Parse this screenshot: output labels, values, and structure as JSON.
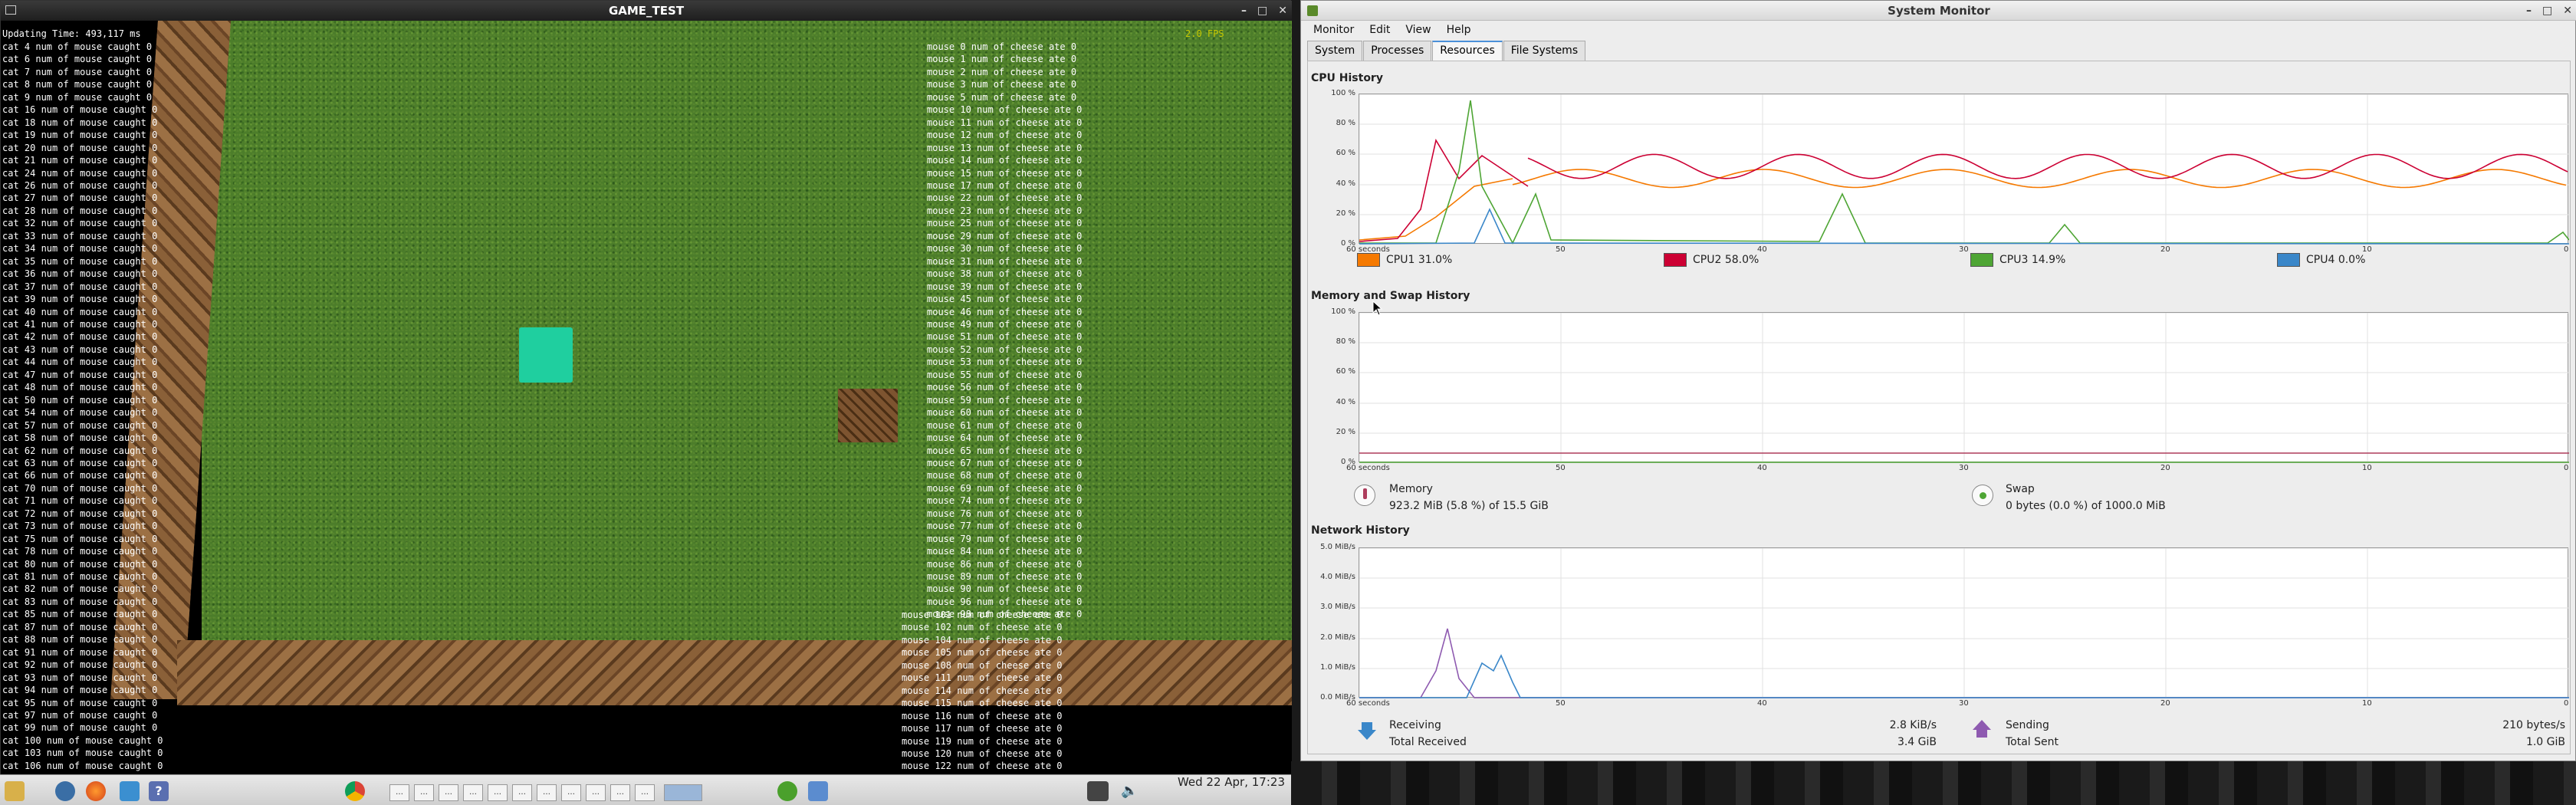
{
  "game": {
    "title": "GAME_TEST",
    "updating": "Updating Time: 493,117 ms",
    "fps": "2.0 FPS",
    "cat_lines": [
      "cat 4 num of mouse caught 0",
      "cat 6 num of mouse caught 0",
      "cat 7 num of mouse caught 0",
      "cat 8 num of mouse caught 0",
      "cat 9 num of mouse caught 0",
      "cat 16 num of mouse caught 0",
      "cat 18 num of mouse caught 0",
      "cat 19 num of mouse caught 0",
      "cat 20 num of mouse caught 0",
      "cat 21 num of mouse caught 0",
      "cat 24 num of mouse caught 0",
      "cat 26 num of mouse caught 0",
      "cat 27 num of mouse caught 0",
      "cat 28 num of mouse caught 0",
      "cat 32 num of mouse caught 0",
      "cat 33 num of mouse caught 0",
      "cat 34 num of mouse caught 0",
      "cat 35 num of mouse caught 0",
      "cat 36 num of mouse caught 0",
      "cat 37 num of mouse caught 0",
      "cat 39 num of mouse caught 0",
      "cat 40 num of mouse caught 0",
      "cat 41 num of mouse caught 0",
      "cat 42 num of mouse caught 0",
      "cat 43 num of mouse caught 0",
      "cat 44 num of mouse caught 0",
      "cat 47 num of mouse caught 0",
      "cat 48 num of mouse caught 0",
      "cat 50 num of mouse caught 0",
      "cat 54 num of mouse caught 0",
      "cat 57 num of mouse caught 0",
      "cat 58 num of mouse caught 0",
      "cat 62 num of mouse caught 0",
      "cat 63 num of mouse caught 0",
      "cat 66 num of mouse caught 0",
      "cat 70 num of mouse caught 0",
      "cat 71 num of mouse caught 0",
      "cat 72 num of mouse caught 0",
      "cat 73 num of mouse caught 0",
      "cat 75 num of mouse caught 0",
      "cat 78 num of mouse caught 0",
      "cat 80 num of mouse caught 0",
      "cat 81 num of mouse caught 0",
      "cat 82 num of mouse caught 0",
      "cat 83 num of mouse caught 0",
      "cat 85 num of mouse caught 0",
      "cat 87 num of mouse caught 0",
      "cat 88 num of mouse caught 0",
      "cat 91 num of mouse caught 0",
      "cat 92 num of mouse caught 0",
      "cat 93 num of mouse caught 0",
      "cat 94 num of mouse caught 0",
      "cat 95 num of mouse caught 0",
      "cat 97 num of mouse caught 0",
      "cat 99 num of mouse caught 0",
      "cat 100 num of mouse caught 0",
      "cat 103 num of mouse caught 0",
      "cat 106 num of mouse caught 0"
    ],
    "mouse_top": [
      "mouse 0 num of cheese ate 0",
      "mouse 1 num of cheese ate 0",
      "mouse 2 num of cheese ate 0",
      "mouse 3 num of cheese ate 0",
      "mouse 5 num of cheese ate 0",
      "mouse 10 num of cheese ate 0",
      "mouse 11 num of cheese ate 0",
      "mouse 12 num of cheese ate 0",
      "mouse 13 num of cheese ate 0",
      "mouse 14 num of cheese ate 0",
      "mouse 15 num of cheese ate 0",
      "mouse 17 num of cheese ate 0",
      "mouse 22 num of cheese ate 0",
      "mouse 23 num of cheese ate 0",
      "mouse 25 num of cheese ate 0",
      "mouse 29 num of cheese ate 0",
      "mouse 30 num of cheese ate 0",
      "mouse 31 num of cheese ate 0",
      "mouse 38 num of cheese ate 0",
      "mouse 39 num of cheese ate 0",
      "mouse 45 num of cheese ate 0",
      "mouse 46 num of cheese ate 0",
      "mouse 49 num of cheese ate 0",
      "mouse 51 num of cheese ate 0",
      "mouse 52 num of cheese ate 0",
      "mouse 53 num of cheese ate 0",
      "mouse 55 num of cheese ate 0",
      "mouse 56 num of cheese ate 0",
      "mouse 59 num of cheese ate 0",
      "mouse 60 num of cheese ate 0",
      "mouse 61 num of cheese ate 0",
      "mouse 64 num of cheese ate 0",
      "mouse 65 num of cheese ate 0",
      "mouse 67 num of cheese ate 0",
      "mouse 68 num of cheese ate 0",
      "mouse 69 num of cheese ate 0",
      "mouse 74 num of cheese ate 0",
      "mouse 76 num of cheese ate 0",
      "mouse 77 num of cheese ate 0",
      "mouse 79 num of cheese ate 0",
      "mouse 84 num of cheese ate 0",
      "mouse 86 num of cheese ate 0",
      "mouse 89 num of cheese ate 0",
      "mouse 90 num of cheese ate 0",
      "mouse 96 num of cheese ate 0",
      "mouse 98 num of cheese ate 0"
    ],
    "mouse_bottom": [
      "mouse 101 num of cheese ate 0",
      "mouse 102 num of cheese ate 0",
      "mouse 104 num of cheese ate 0",
      "mouse 105 num of cheese ate 0",
      "mouse 108 num of cheese ate 0",
      "mouse 111 num of cheese ate 0",
      "mouse 114 num of cheese ate 0",
      "mouse 115 num of cheese ate 0",
      "mouse 116 num of cheese ate 0",
      "mouse 117 num of cheese ate 0",
      "mouse 119 num of cheese ate 0",
      "mouse 120 num of cheese ate 0",
      "mouse 122 num of cheese ate 0"
    ]
  },
  "taskbar": {
    "clock": "Wed 22 Apr, 17:23",
    "icons": [
      "settings-icon",
      "app-icon",
      "firefox-icon",
      "tool-icon",
      "help-icon",
      "chrome-icon",
      "runner-icon",
      "folder-icon"
    ]
  },
  "sysmon": {
    "title": "System Monitor",
    "menu": [
      "Monitor",
      "Edit",
      "View",
      "Help"
    ],
    "tabs": [
      "System",
      "Processes",
      "Resources",
      "File Systems"
    ],
    "active_tab": "Resources",
    "cpu": {
      "title": "CPU History",
      "yticks": [
        "100 %",
        "80 %",
        "60 %",
        "40 %",
        "20 %",
        "0 %"
      ],
      "xticks": [
        "60 seconds",
        "50",
        "40",
        "30",
        "20",
        "10",
        "0"
      ],
      "legend": [
        {
          "label": "CPU1",
          "value": "31.0%",
          "color": "#f57900"
        },
        {
          "label": "CPU2",
          "value": "58.0%",
          "color": "#cc0033"
        },
        {
          "label": "CPU3",
          "value": "14.9%",
          "color": "#4ea534"
        },
        {
          "label": "CPU4",
          "value": "0.0%",
          "color": "#3a87c9"
        }
      ]
    },
    "mem": {
      "title": "Memory and Swap History",
      "yticks": [
        "100 %",
        "80 %",
        "60 %",
        "40 %",
        "20 %",
        "0 %"
      ],
      "xticks": [
        "60 seconds",
        "50",
        "40",
        "30",
        "20",
        "10",
        "0"
      ],
      "memory_label": "Memory",
      "memory_value": "923.2 MiB (5.8 %) of 15.5 GiB",
      "swap_label": "Swap",
      "swap_value": "0 bytes (0.0 %) of 1000.0 MiB",
      "memory_color": "#ad3c5c",
      "swap_color": "#4ea534"
    },
    "net": {
      "title": "Network History",
      "yticks": [
        "5.0 MiB/s",
        "4.0 MiB/s",
        "3.0 MiB/s",
        "2.0 MiB/s",
        "1.0 MiB/s",
        "0.0 MiB/s"
      ],
      "xticks": [
        "60 seconds",
        "50",
        "40",
        "30",
        "20",
        "10",
        "0"
      ],
      "receiving_label": "Receiving",
      "receiving_value": "2.8 KiB/s",
      "total_received_label": "Total Received",
      "total_received_value": "3.4 GiB",
      "sending_label": "Sending",
      "sending_value": "210 bytes/s",
      "total_sent_label": "Total Sent",
      "total_sent_value": "1.0 GiB",
      "receive_color": "#3a87c9",
      "send_color": "#8e5ab0"
    }
  }
}
